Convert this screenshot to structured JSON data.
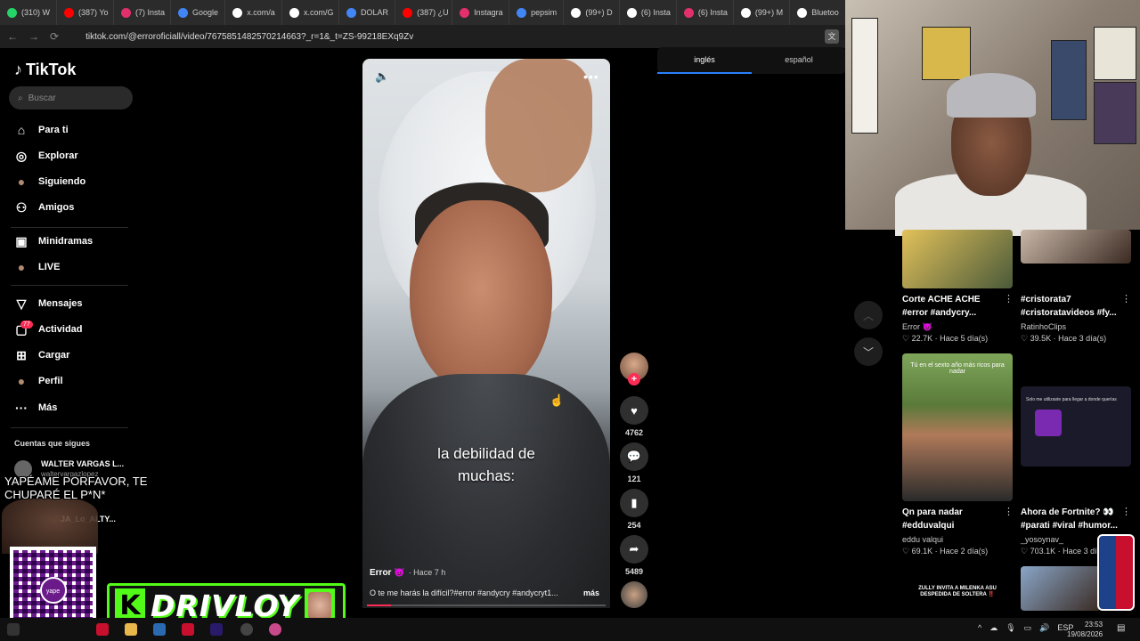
{
  "browser": {
    "tabs": [
      {
        "label": "(310) W",
        "icon": "whatsapp-icon",
        "color": "#25d366"
      },
      {
        "label": "(387) Yo",
        "icon": "youtube-icon",
        "color": "#ff0000"
      },
      {
        "label": "(7) Insta",
        "icon": "instagram-icon",
        "color": "#e1306c"
      },
      {
        "label": "Google",
        "icon": "google-icon",
        "color": "#4285f4"
      },
      {
        "label": "x.com/a",
        "icon": "x-icon",
        "color": "#ffffff"
      },
      {
        "label": "x.com/G",
        "icon": "x-icon",
        "color": "#ffffff"
      },
      {
        "label": "DOLAR",
        "icon": "google-icon",
        "color": "#4285f4"
      },
      {
        "label": "(387) ¿U",
        "icon": "youtube-icon",
        "color": "#ff0000"
      },
      {
        "label": "Instagra",
        "icon": "instagram-icon",
        "color": "#e1306c"
      },
      {
        "label": "pepsim",
        "icon": "google-icon",
        "color": "#4285f4"
      },
      {
        "label": "(99+) D",
        "icon": "tiktok-icon",
        "color": "#ffffff"
      },
      {
        "label": "(6) Insta",
        "icon": "tiktok-icon",
        "color": "#ffffff"
      },
      {
        "label": "(6) Insta",
        "icon": "instagram-icon",
        "color": "#e1306c"
      },
      {
        "label": "(99+) M",
        "icon": "tiktok-icon",
        "color": "#ffffff"
      },
      {
        "label": "Bluetoo",
        "icon": "tiktok-icon",
        "color": "#ffffff"
      }
    ],
    "url": "tiktok.com/@erroroficiall/video/7675851482570214663?_r=1&_t=ZS-99218EXq9Zv"
  },
  "sidebar": {
    "logo": "TikTok",
    "search_placeholder": "Buscar",
    "items": [
      {
        "label": "Para ti",
        "icon": "home-icon"
      },
      {
        "label": "Explorar",
        "icon": "compass-icon"
      },
      {
        "label": "Siguiendo",
        "icon": "following-avatar-icon"
      },
      {
        "label": "Amigos",
        "icon": "friends-icon"
      },
      {
        "label": "Minidramas",
        "icon": "film-icon"
      },
      {
        "label": "LIVE",
        "icon": "live-icon"
      },
      {
        "label": "Mensajes",
        "icon": "send-icon"
      },
      {
        "label": "Actividad",
        "icon": "inbox-icon"
      },
      {
        "label": "Cargar",
        "icon": "plus-square-icon"
      },
      {
        "label": "Perfil",
        "icon": "profile-avatar-icon"
      },
      {
        "label": "Más",
        "icon": "more-icon"
      }
    ],
    "activity_badge": "77",
    "following_title": "Cuentas que sigues",
    "following": [
      {
        "name": "WALTER VARGAS L...",
        "handle": "waltervargazlopez"
      },
      {
        "name": "JA_Lo_ALTY...",
        "handle": ""
      }
    ]
  },
  "video": {
    "caption_line1": "la debilidad de",
    "caption_line2": "muchas:",
    "author": "Error 😈",
    "time": "· Hace 7 h",
    "description": "O te me harás la difícil?#error #andycry #andycryt1...",
    "more_label": "más",
    "progress": 0.1,
    "likes": "4762",
    "comments": "121",
    "saves": "254",
    "shares": "5489"
  },
  "language_tabs": {
    "items": [
      "inglés",
      "español"
    ],
    "active": 0
  },
  "feed": [
    {
      "title1": "Corte ACHE ACHE",
      "title2": "#error #andycry...",
      "user": "Error 😈",
      "views": "22.7K",
      "age": "Hace 5 día(s)"
    },
    {
      "title1": "#cristorata7",
      "title2": "#cristoratavideos #fy...",
      "user": "RatinhoClips",
      "views": "39.5K",
      "age": "Hace 3 día(s)"
    },
    {
      "title1": "Qn para nadar",
      "title2": "#edduvalqui",
      "user": "eddu valqui",
      "views": "69.1K",
      "age": "Hace 2 día(s)",
      "thumb_text": "Tú en el sexto año más ricos para nadar"
    },
    {
      "title1": "Ahora de Fortnite? 👀",
      "title2": "#parati #viral #humor...",
      "user": "_yosoynav_",
      "views": "703.1K",
      "age": "Hace 3 día(s)",
      "thumb_text": "Solo me utilizaste para llegar a donde querías"
    },
    {
      "thumb_text": "ZULLY INVITA A MILENKA ASU DESPEDIDA DE SOLTERA ‼️"
    }
  ],
  "overlay": {
    "donation_text": "YAPÉAME PORFAVOR, TE CHUPARÉ  EL P*N*",
    "qr_label": "yape",
    "brand": "DRIVLOY"
  },
  "taskbar": {
    "lang": "ESP",
    "time": "23:53",
    "date": "19/08/2026"
  },
  "colors": {
    "accent": "#fe2c55",
    "kick_green": "#53fc18",
    "tab_active": "#2a7fff"
  }
}
